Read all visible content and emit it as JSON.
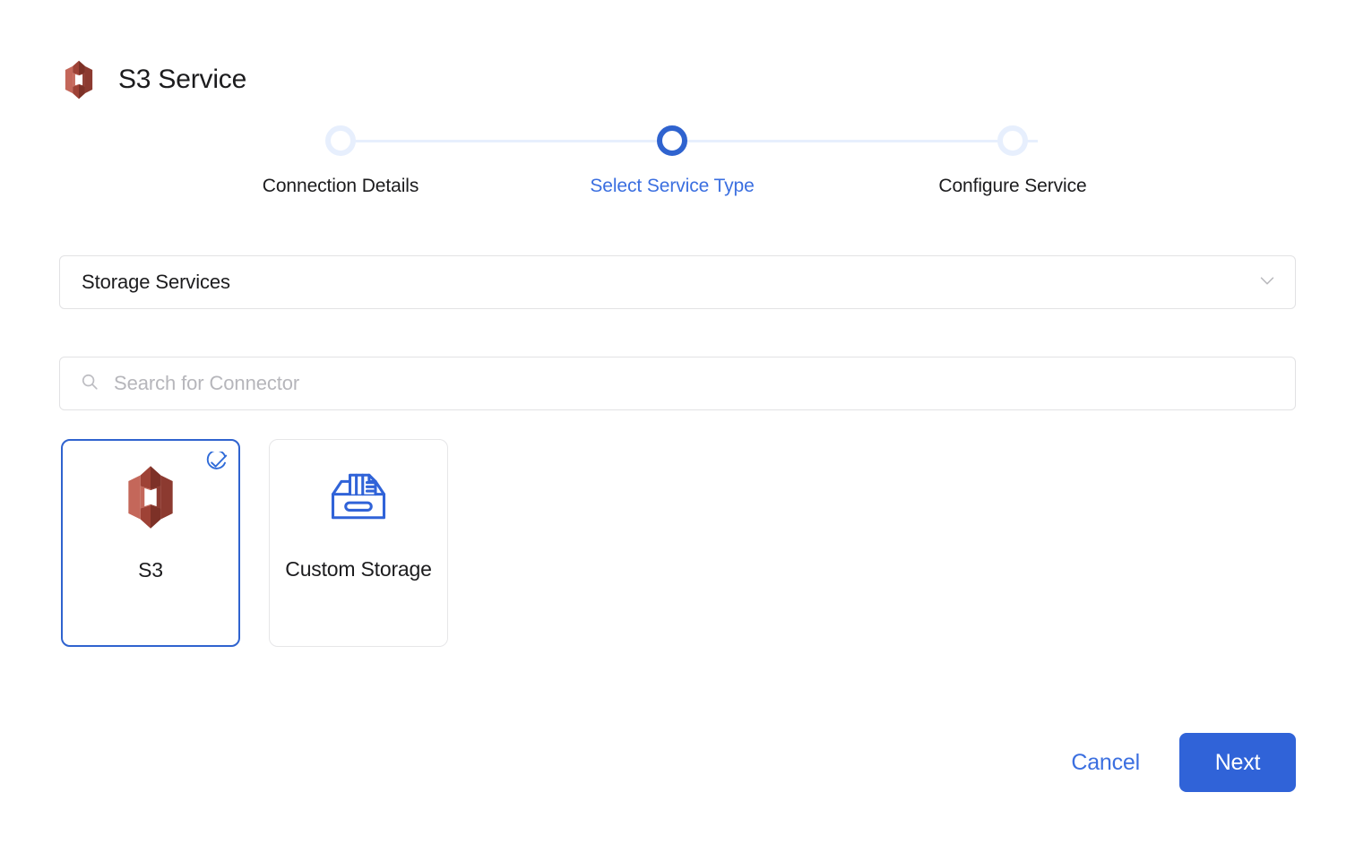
{
  "header": {
    "title": "S3 Service",
    "icon": "s3-logo-icon"
  },
  "stepper": {
    "steps": [
      {
        "label": "Select Service Type",
        "state": "active"
      },
      {
        "label": "Configure Service",
        "state": "inactive"
      },
      {
        "label": "Connection Details",
        "state": "inactive"
      }
    ]
  },
  "service_category": {
    "selected": "Storage Services",
    "chevron_icon": "chevron-down-icon"
  },
  "search": {
    "value": "",
    "placeholder": "Search for Connector",
    "icon": "search-icon"
  },
  "connectors": [
    {
      "label": "S3",
      "icon": "s3-logo-icon",
      "selected": true,
      "badge_icon": "check-circle-icon"
    },
    {
      "label": "Custom Storage",
      "icon": "file-box-icon",
      "selected": false
    }
  ],
  "footer": {
    "cancel_label": "Cancel",
    "next_label": "Next"
  },
  "colors": {
    "accent_blue": "#3063d8",
    "link_blue": "#3b6fe0",
    "step_active": "#2f63cf",
    "step_inactive": "#e7effd",
    "s3_red": "#b4564a",
    "border_grey": "#e2e2e4",
    "placeholder_grey": "#b6b6bb"
  }
}
